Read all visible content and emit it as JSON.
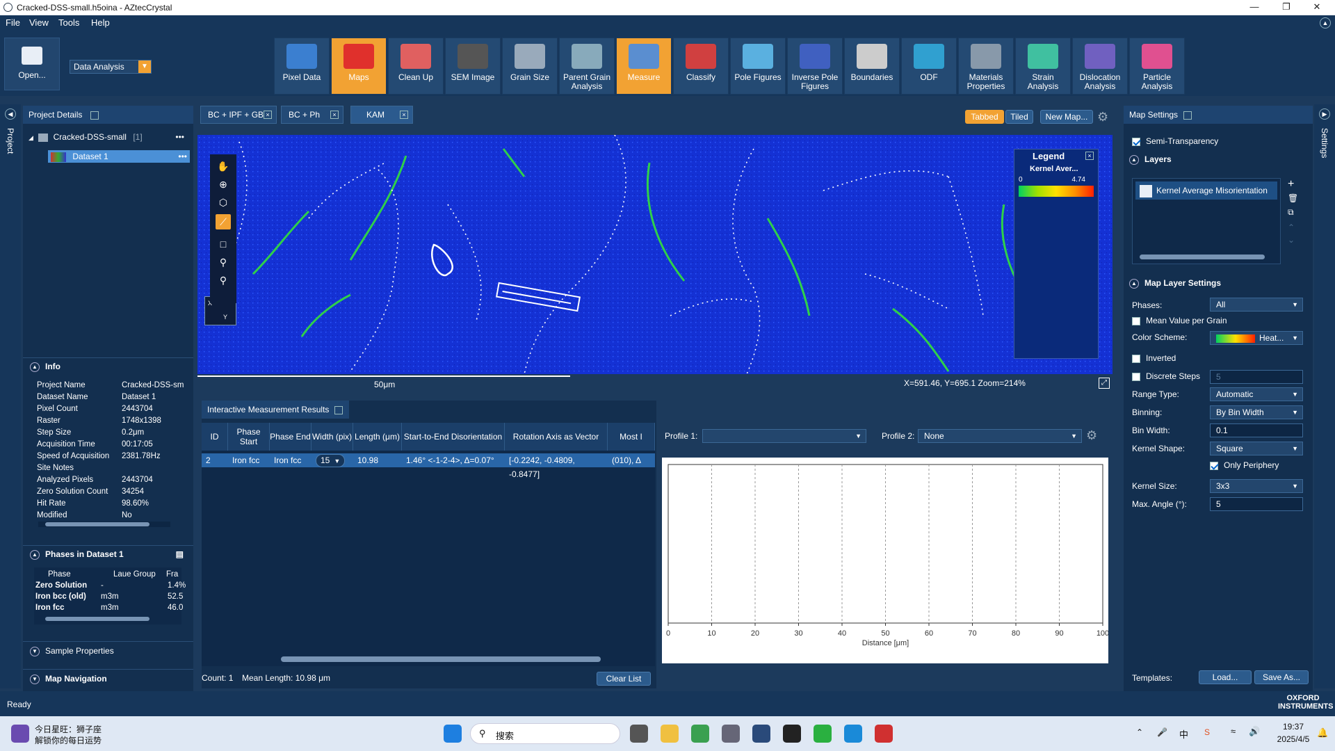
{
  "window": {
    "title": "Cracked-DSS-small.h5oina - AZtecCrystal"
  },
  "menu": [
    "File",
    "View",
    "Tools",
    "Help"
  ],
  "ribbon": {
    "open_label": "Open...",
    "mode": "Data Analysis",
    "items": [
      {
        "label": "Pixel Data",
        "color": "#3b7fd0"
      },
      {
        "label": "Maps",
        "color": "#e0302c",
        "active": true
      },
      {
        "label": "Clean Up",
        "color": "#e06060"
      },
      {
        "label": "SEM Image",
        "color": "#555555"
      },
      {
        "label": "Grain Size",
        "color": "#9ab"
      },
      {
        "label": "Parent Grain Analysis",
        "color": "#8ab"
      },
      {
        "label": "Measure",
        "color": "#5a8ed0",
        "active": true
      },
      {
        "label": "Classify",
        "color": "#d04040"
      },
      {
        "label": "Pole Figures",
        "color": "#5ab0e0"
      },
      {
        "label": "Inverse Pole Figures",
        "color": "#4060c0"
      },
      {
        "label": "Boundaries",
        "color": "#ccc"
      },
      {
        "label": "ODF",
        "color": "#30a0d0"
      },
      {
        "label": "Materials Properties",
        "color": "#8899aa"
      },
      {
        "label": "Strain Analysis",
        "color": "#40c0a0"
      },
      {
        "label": "Dislocation Analysis",
        "color": "#7060c0"
      },
      {
        "label": "Particle Analysis",
        "color": "#e05090"
      }
    ]
  },
  "left": {
    "strip_label": "Project",
    "header": "Project Details",
    "tree_root": "Cracked-DSS-small",
    "tree_count": "[1]",
    "dataset": "Dataset 1",
    "info_title": "Info",
    "info": [
      [
        "Project Name",
        "Cracked-DSS-sm"
      ],
      [
        "Dataset Name",
        "Dataset 1"
      ],
      [
        "Pixel Count",
        "2443704"
      ],
      [
        "Raster",
        "1748x1398"
      ],
      [
        "Step Size",
        "0.2μm"
      ],
      [
        "Acquisition Time",
        "00:17:05"
      ],
      [
        "Speed of Acquisition",
        "2381.78Hz"
      ],
      [
        "Site Notes",
        ""
      ],
      [
        "Analyzed Pixels",
        "2443704"
      ],
      [
        "Zero Solution Count",
        "34254"
      ],
      [
        "Hit Rate",
        "98.60%"
      ],
      [
        "Modified",
        "No"
      ]
    ],
    "phases_title": "Phases in Dataset 1",
    "phase_headers": [
      "Phase",
      "Laue Group",
      "Fra"
    ],
    "phases": [
      [
        "Zero Solution",
        "-",
        "1.4%"
      ],
      [
        "Iron bcc (old)",
        "m3m",
        "52.5"
      ],
      [
        "Iron fcc",
        "m3m",
        "46.0"
      ]
    ],
    "sample_props": "Sample Properties",
    "map_nav": "Map Navigation"
  },
  "tabs": [
    "BC + IPF + GB",
    "BC + Ph",
    "KAM"
  ],
  "view_modes": {
    "tabbed": "Tabbed",
    "tiled": "Tiled",
    "new_map": "New Map..."
  },
  "map": {
    "legend_title": "Legend",
    "legend_layer": "Kernel Aver...",
    "legend_min": "0",
    "legend_max": "4.74",
    "scale": "50μm",
    "coords": "X=591.46, Y=695.1 Zoom=214%"
  },
  "results": {
    "title": "Interactive Measurement Results",
    "headers": [
      "ID",
      "Phase Start",
      "Phase End",
      "Width (pix)",
      "Length (μm)",
      "Start-to-End Disorientation",
      "Rotation Axis as Vector",
      "Most I"
    ],
    "row": [
      "2",
      "Iron fcc",
      "Iron fcc",
      "15",
      "10.98",
      "1.46° <-1-2-4>, Δ=0.07°",
      "[-0.2242, -0.4809, -0.8477]",
      "(010), Δ"
    ],
    "count": "Count:  1",
    "mean": "Mean Length:  10.98 μm",
    "clear": "Clear List"
  },
  "profile": {
    "p1_label": "Profile 1:",
    "p1_value": "",
    "p2_label": "Profile 2:",
    "p2_value": "None"
  },
  "chart_data": {
    "type": "line",
    "x_ticks": [
      "0",
      "10",
      "20",
      "30",
      "40",
      "50",
      "60",
      "70",
      "80",
      "90",
      "100"
    ],
    "xlabel": "Distance [μm]",
    "xlim": [
      0,
      100
    ],
    "series": [],
    "grid": true
  },
  "right": {
    "strip_label": "Settings",
    "header": "Map Settings",
    "semi": "Semi-Transparency",
    "layers": "Layers",
    "layer_item": "Kernel Average Misorientation",
    "mls": "Map Layer Settings",
    "phases_label": "Phases:",
    "phases_val": "All",
    "mean_grain": "Mean Value per Grain",
    "color_scheme": "Color Scheme:",
    "color_val": "Heat...",
    "inverted": "Inverted",
    "discrete": "Discrete Steps",
    "discrete_val": "5",
    "range_type": "Range Type:",
    "range_val": "Automatic",
    "binning": "Binning:",
    "binning_val": "By Bin Width",
    "bin_width": "Bin Width:",
    "bin_width_val": "0.1",
    "kernel_shape": "Kernel Shape:",
    "kernel_shape_val": "Square",
    "only_periphery": "Only Periphery",
    "kernel_size": "Kernel Size:",
    "kernel_size_val": "3x3",
    "max_angle": "Max. Angle (°):",
    "max_angle_val": "5",
    "templates": "Templates:",
    "load": "Load...",
    "saveas": "Save As..."
  },
  "status": {
    "text": "Ready",
    "brand": "OXFORD INSTRUMENTS"
  },
  "taskbar": {
    "news1": "今日星旺：狮子座",
    "news2": "解锁你的每日运势",
    "search": "搜索",
    "lang": "中",
    "time": "19:37",
    "date": "2025/4/5"
  }
}
